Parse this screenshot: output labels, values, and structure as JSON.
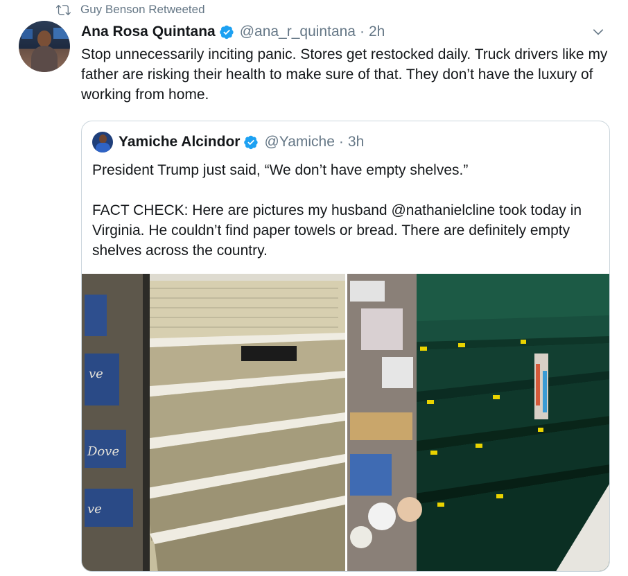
{
  "retweet": {
    "label": "Guy Benson Retweeted",
    "icon": "retweet-icon"
  },
  "tweet": {
    "author_name": "Ana Rosa Quintana",
    "handle": "@ana_r_quintana",
    "separator": "·",
    "time": "2h",
    "text": "Stop unnecessarily inciting panic. Stores get restocked daily. Truck drivers like my father are risking their health to make sure of that. They don’t have the luxury of working from home.",
    "verified_color": "#1da1f2"
  },
  "quoted": {
    "author_name": "Yamiche Alcindor",
    "handle": "@Yamiche",
    "separator": "·",
    "time": "3h",
    "paragraph_1": "President Trump just said, “We don’t have empty shelves.”",
    "paragraph_2": "FACT CHECK: Here are pictures my husband @nathanielcline took today in Virginia. He couldn’t find paper towels or bread. There are definitely empty shelves across the country."
  },
  "colors": {
    "secondary_text": "#657786",
    "border": "#ccd6dd"
  }
}
